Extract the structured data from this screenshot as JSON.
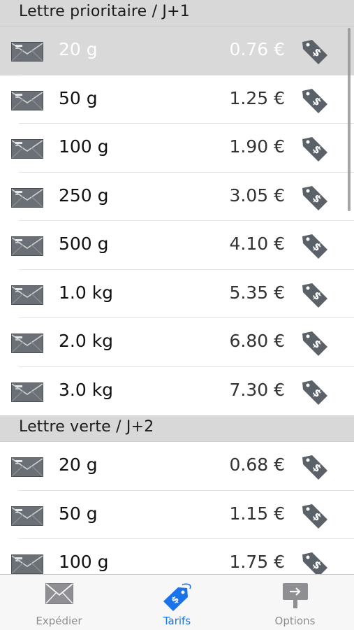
{
  "sections": [
    {
      "title": "Lettre prioritaire / J+1",
      "rows": [
        {
          "weight": "20 g",
          "price": "0.76 €"
        },
        {
          "weight": "50 g",
          "price": "1.25 €"
        },
        {
          "weight": "100 g",
          "price": "1.90 €"
        },
        {
          "weight": "250 g",
          "price": "3.05 €"
        },
        {
          "weight": "500 g",
          "price": "4.10 €"
        },
        {
          "weight": "1.0 kg",
          "price": "5.35 €"
        },
        {
          "weight": "2.0 kg",
          "price": "6.80 €"
        },
        {
          "weight": "3.0 kg",
          "price": "7.30 €"
        }
      ]
    },
    {
      "title": "Lettre verte / J+2",
      "rows": [
        {
          "weight": "20 g",
          "price": "0.68 €"
        },
        {
          "weight": "50 g",
          "price": "1.15 €"
        },
        {
          "weight": "100 g",
          "price": "1.75 €"
        }
      ]
    }
  ],
  "tabs": [
    {
      "label": "Expédier",
      "icon": "envelope-icon"
    },
    {
      "label": "Tarifs",
      "icon": "price-tag-icon"
    },
    {
      "label": "Options",
      "icon": "signpost-icon"
    }
  ],
  "colors": {
    "accent": "#1a73e8",
    "tag": "#5b6168",
    "envelope": "#6b7076"
  }
}
